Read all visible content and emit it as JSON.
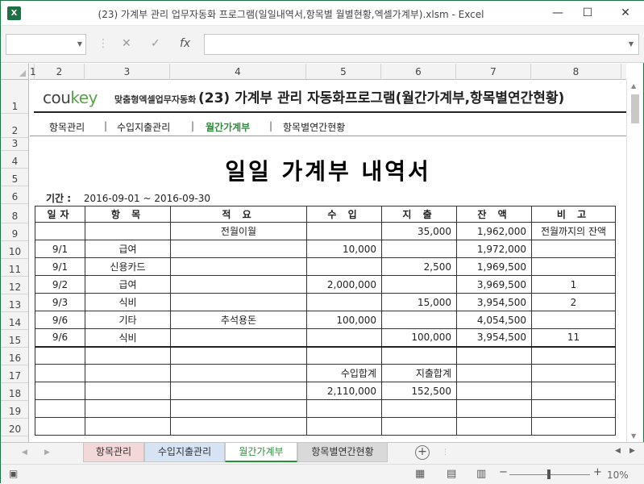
{
  "window": {
    "title": "(23) 가계부 관리 업무자동화 프로그램(일일내역서,항목별 월별현황,엑셀가계부).xlsm - Excel",
    "app_icon": "X"
  },
  "formula_bar": {
    "name_box": "",
    "cancel": "✕",
    "enter": "✓",
    "fx": "fx",
    "value": ""
  },
  "columns": [
    "1",
    "2",
    "3",
    "4",
    "5",
    "6",
    "7",
    "8"
  ],
  "rows": [
    "1",
    "2",
    "3",
    "4",
    "5",
    "6",
    "8",
    "9",
    "10",
    "11",
    "12",
    "13",
    "14",
    "15",
    "16",
    "17",
    "18",
    "19",
    "20"
  ],
  "banner": {
    "logo_main": "cou",
    "logo_accent": "key",
    "logo_sub": "맞춤형엑셀업무자동화",
    "title": "(23) 가계부 관리 자동화프로그램(월간가계부,항목별연간현황)"
  },
  "nav": {
    "items": [
      {
        "label": "항목관리"
      },
      {
        "label": "수입지출관리"
      },
      {
        "label": "월간가계부"
      },
      {
        "label": "항목별연간현황"
      }
    ],
    "separator": "|"
  },
  "document": {
    "title": "일일 가계부 내역서",
    "period_label": "기간 :",
    "period_value": "2016-09-01 ~ 2016-09-30"
  },
  "table": {
    "headers": [
      "일자",
      "항 목",
      "적 요",
      "수 입",
      "지 출",
      "잔 액",
      "비 고"
    ],
    "rows": [
      [
        "",
        "",
        "전월이월",
        "",
        "35,000",
        "1,962,000",
        "전월까지의 잔액"
      ],
      [
        "9/1",
        "급여",
        "",
        "10,000",
        "",
        "1,972,000",
        ""
      ],
      [
        "9/1",
        "신용카드",
        "",
        "",
        "2,500",
        "1,969,500",
        ""
      ],
      [
        "9/2",
        "급여",
        "",
        "2,000,000",
        "",
        "3,969,500",
        "1"
      ],
      [
        "9/3",
        "식비",
        "",
        "",
        "15,000",
        "3,954,500",
        "2"
      ],
      [
        "9/6",
        "기타",
        "추석용돈",
        "100,000",
        "",
        "4,054,500",
        ""
      ],
      [
        "9/6",
        "식비",
        "",
        "",
        "100,000",
        "3,954,500",
        "11"
      ],
      [
        "",
        "",
        "",
        "",
        "",
        "",
        ""
      ],
      [
        "",
        "",
        "",
        "수입합계",
        "지출합계",
        "",
        ""
      ],
      [
        "",
        "",
        "",
        "2,110,000",
        "152,500",
        "",
        ""
      ],
      [
        "",
        "",
        "",
        "",
        "",
        "",
        ""
      ],
      [
        "",
        "",
        "",
        "",
        "",
        "",
        ""
      ]
    ]
  },
  "sheet_tabs": [
    {
      "label": "항목관리",
      "color": "#f4d7d7"
    },
    {
      "label": "수입지출관리",
      "color": "#d6e3f5"
    },
    {
      "label": "월간가계부",
      "color": "#ffffff",
      "active": true
    },
    {
      "label": "항목별연간현황",
      "color": "#d9d9d9"
    }
  ],
  "status": {
    "zoom": "10%"
  }
}
